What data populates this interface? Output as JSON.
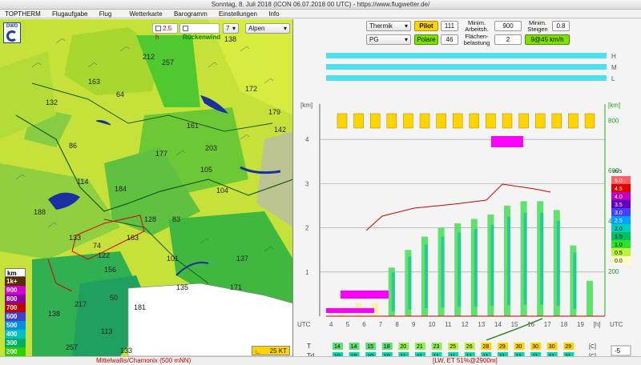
{
  "window": {
    "title": "Sonntag, 8. Juli 2018 (ICON 06.07.2018 00 UTC) - https://www.flugwetter.de/"
  },
  "menu": [
    "TOPTHERM",
    "Flugaufgabe",
    "Flug",
    "Wetterkarte",
    "Barogramm",
    "Einstellungen",
    "Info"
  ],
  "map": {
    "time_label": "2.5 h",
    "tailwind_label": "Rückenwind",
    "tailwind_value": "7",
    "region_select": "Alpen",
    "wind_scale": "25 KT",
    "logo": "DWD",
    "values": [
      "138",
      "212",
      "257",
      "163",
      "64",
      "172",
      "132",
      "179",
      "142",
      "161",
      "203",
      "86",
      "177",
      "105",
      "114",
      "184",
      "104",
      "188",
      "128",
      "83",
      "133",
      "74",
      "163",
      "122",
      "101",
      "137",
      "156",
      "135",
      "171",
      "50",
      "217",
      "181",
      "138",
      "257",
      "113",
      "133"
    ],
    "legend_unit": "km",
    "legend": [
      {
        "label": "1k+",
        "color": "#5a2a00"
      },
      {
        "label": "900",
        "color": "#d000d0"
      },
      {
        "label": "800",
        "color": "#9000a0"
      },
      {
        "label": "700",
        "color": "#c00000"
      },
      {
        "label": "600",
        "color": "#4040d0"
      },
      {
        "label": "500",
        "color": "#0090e0"
      },
      {
        "label": "400",
        "color": "#00c0c0"
      },
      {
        "label": "300",
        "color": "#00b060"
      },
      {
        "label": "200",
        "color": "#30d000"
      },
      {
        "label": "100",
        "color": "#c0e000"
      }
    ]
  },
  "controls": {
    "thermik": "Thermik",
    "pilot_label": "Pilot",
    "pilot_value": "111",
    "min_arbeit_label": "Minim. Arbeitsh.",
    "min_arbeit_value": "900",
    "min_steigen_label": "Minim. Steigen",
    "min_steigen_value": "0.8",
    "pg": "PG",
    "polare_label": "Polare",
    "polare_value": "46",
    "flaechen_label": "Flächen-belastung",
    "flaechen_value": "2",
    "speed_value": "9@45 km/h"
  },
  "chart_data": {
    "type": "heatmap",
    "title": "",
    "xlabel": "UTC",
    "x_ticks": [
      "4",
      "5",
      "6",
      "7",
      "8",
      "9",
      "10",
      "11",
      "12",
      "13",
      "14",
      "15",
      "16",
      "17",
      "18",
      "19",
      "[h]"
    ],
    "y_left_label": "[km]",
    "y_left_ticks": [
      "1",
      "2",
      "3",
      "4"
    ],
    "y_right_label": "[km]",
    "y_right_ticks": [
      "200",
      "400",
      "600",
      "800"
    ],
    "ms_scale_label": "m/s",
    "ms_scale": [
      "5.0",
      "4.5",
      "4.0",
      "3.5",
      "3.0",
      "2.5",
      "2.0",
      "1.5",
      "1.0",
      "0.5",
      "0.0"
    ],
    "row_labels": [
      "H",
      "M",
      "L"
    ],
    "temp_row": {
      "label": "T",
      "unit": "[C]",
      "values": [
        "14",
        "14",
        "15",
        "18",
        "20",
        "21",
        "23",
        "25",
        "26",
        "28",
        "29",
        "30",
        "30",
        "30",
        "29"
      ]
    },
    "dew_row": {
      "label": "Td",
      "unit": "[C]",
      "values": [
        "10",
        "10",
        "10",
        "10",
        "11",
        "11",
        "11",
        "11",
        "11",
        "11",
        "11",
        "11",
        "11",
        "11",
        "11"
      ]
    },
    "zoom_value": "-5",
    "right_top_label": "UTC"
  },
  "status": {
    "location": "Mittelwallis/Chamonix (500 mNN)",
    "info": "[LW, ET 51%@2900m]"
  }
}
